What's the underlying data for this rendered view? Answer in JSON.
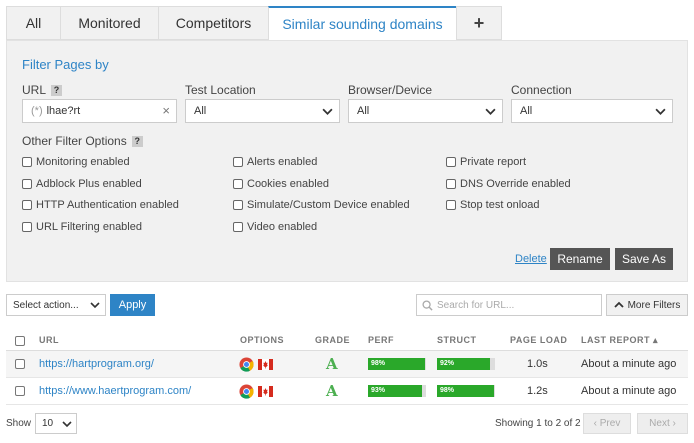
{
  "tabs": [
    {
      "label": "All"
    },
    {
      "label": "Monitored"
    },
    {
      "label": "Competitors"
    },
    {
      "label": "Similar sounding domains"
    },
    {
      "label": "+"
    }
  ],
  "filters": {
    "title": "Filter Pages by",
    "url_label": "URL",
    "help": "?",
    "url_prefix": "(*)",
    "url_value": "lhae?rt",
    "clear": "×",
    "test_location_label": "Test Location",
    "test_location_value": "All",
    "browser_label": "Browser/Device",
    "browser_value": "All",
    "connection_label": "Connection",
    "connection_value": "All",
    "other_label": "Other Filter Options",
    "options": {
      "monitoring": "Monitoring enabled",
      "adblock": "Adblock Plus enabled",
      "http_auth": "HTTP Authentication enabled",
      "url_filtering": "URL Filtering enabled",
      "alerts": "Alerts enabled",
      "cookies": "Cookies enabled",
      "simulate": "Simulate/Custom Device enabled",
      "video": "Video enabled",
      "private": "Private report",
      "dns": "DNS Override enabled",
      "stop": "Stop test onload"
    },
    "delete": "Delete",
    "rename": "Rename",
    "save_as": "Save As"
  },
  "toolbar": {
    "select_action": "Select action...",
    "apply": "Apply",
    "search_placeholder": "Search for URL...",
    "more_filters": "More Filters"
  },
  "table": {
    "headers": {
      "url": "URL",
      "options": "OPTIONS",
      "grade": "GRADE",
      "perf": "PERF",
      "struct": "STRUCT",
      "page_load": "PAGE LOAD",
      "last_report": "LAST REPORT ▴"
    },
    "rows": [
      {
        "url": "https://hartprogram.org/",
        "grade": "A",
        "perf_label": "98%",
        "perf": 98,
        "struct_label": "92%",
        "struct": 92,
        "load": "1.0s",
        "last": "About a minute ago"
      },
      {
        "url": "https://www.haertprogram.com/",
        "grade": "A",
        "perf_label": "93%",
        "perf": 93,
        "struct_label": "98%",
        "struct": 98,
        "load": "1.2s",
        "last": "About a minute ago"
      }
    ]
  },
  "footer": {
    "show": "Show",
    "per_page": "10",
    "showing": "Showing 1 to 2 of 2",
    "prev": "‹ Prev",
    "next": "Next ›"
  },
  "colors": {
    "accent": "#2e84c6",
    "score_green": "#2aa82a",
    "grade_green": "#4caf50"
  }
}
